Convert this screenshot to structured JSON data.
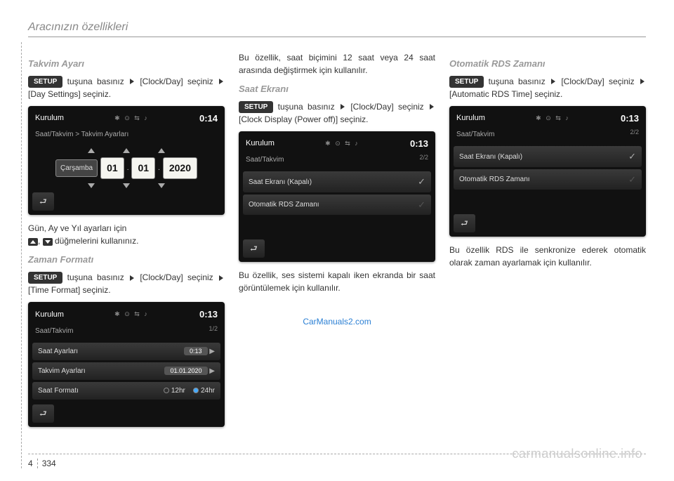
{
  "header": "Aracınızın özellikleri",
  "footer": {
    "chapter": "4",
    "page": "334"
  },
  "watermark": "carmanualsonline.info",
  "link": "CarManuals2.com",
  "setup_label": "SETUP",
  "col1": {
    "sec1": {
      "title": "Takvim Ayarı",
      "text1a": " tuşuna basınız ",
      "text1b": " [Clock/Day] seçiniz ",
      "text1c": " [Day Settings] seçiniz.",
      "screen": {
        "title": "Kurulum",
        "time": "0:14",
        "breadcrumb": "Saat/Takvim > Takvim Ayarları",
        "day": "Çarşamba",
        "d": "01",
        "m": "01",
        "y": "2020"
      },
      "text2a": "Gün, Ay ve Yıl ayarları için",
      "text2b": " düğmelerini kullanınız."
    },
    "sec2": {
      "title": "Zaman Formatı",
      "text1a": " tuşuna basınız ",
      "text1b": " [Clock/Day] seçiniz ",
      "text1c": " [Time Format] seçiniz.",
      "screen": {
        "title": "Kurulum",
        "time": "0:13",
        "breadcrumb": "Saat/Takvim",
        "page": "1/2",
        "row1": "Saat Ayarları",
        "row1v": "0:13",
        "row2": "Takvim Ayarları",
        "row2v": "01.01.2020",
        "row3": "Saat Formatı",
        "row3a": "12hr",
        "row3b": "24hr"
      }
    }
  },
  "col2": {
    "text1": "Bu özellik, saat biçimini 12 saat veya 24 saat arasında değiştirmek için kullanılır.",
    "sec1": {
      "title": "Saat Ekranı",
      "text1a": " tuşuna basınız ",
      "text1b": " [Clock/Day] seçiniz ",
      "text1c": " [Clock Display (Power off)] seçiniz.",
      "screen": {
        "title": "Kurulum",
        "time": "0:13",
        "breadcrumb": "Saat/Takvim",
        "page": "2/2",
        "row1": "Saat Ekranı (Kapalı)",
        "row2": "Otomatik RDS Zamanı"
      },
      "text2": "Bu özellik, ses sistemi kapalı iken ekranda bir saat görüntülemek için kullanılır."
    }
  },
  "col3": {
    "sec1": {
      "title": "Otomatik RDS Zamanı",
      "text1a": " tuşuna basınız ",
      "text1b": " [Clock/Day] seçiniz  ",
      "text1c": " [Automatic RDS Time] seçiniz.",
      "screen": {
        "title": "Kurulum",
        "time": "0:13",
        "breadcrumb": "Saat/Takvim",
        "page": "2/2",
        "row1": "Saat Ekranı (Kapalı)",
        "row2": "Otomatik RDS Zamanı"
      },
      "text2": "Bu özellik RDS ile senkronize ederek otomatik olarak zaman ayarlamak için kullanılır."
    }
  }
}
